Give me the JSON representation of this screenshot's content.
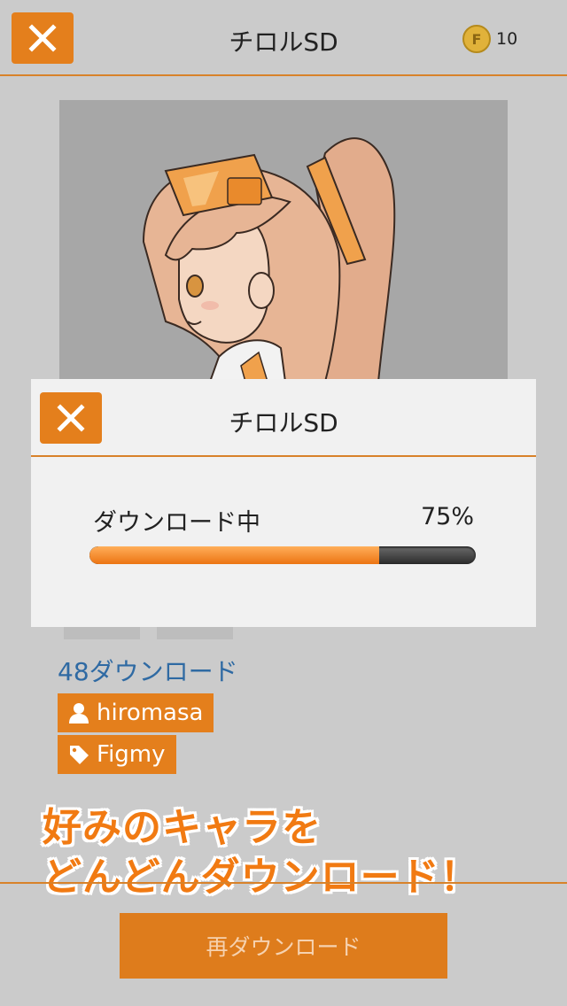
{
  "header": {
    "title": "チロルSD",
    "coin_symbol": "F",
    "coin_count": "10"
  },
  "character": {
    "download_count": "48ダウンロード",
    "author": "hiromasa",
    "tag": "Figmy"
  },
  "promo": {
    "line1": "好みのキャラを",
    "line2": "どんどんダウンロード！"
  },
  "footer": {
    "redownload_label": "再ダウンロード"
  },
  "modal": {
    "title": "チロルSD",
    "label": "ダウンロード中",
    "percent_text": "75%",
    "progress": 0.75
  },
  "colors": {
    "accent": "#e47f1c",
    "link": "#2f6aa3"
  }
}
